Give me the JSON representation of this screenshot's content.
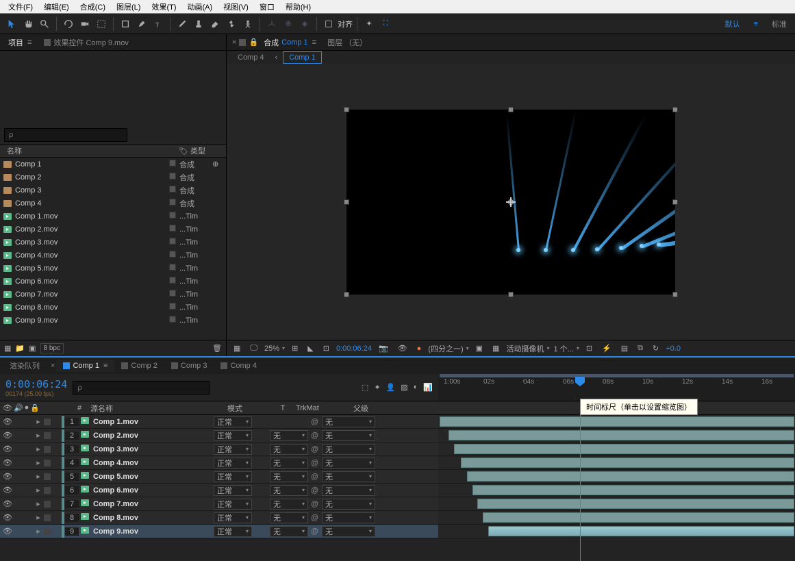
{
  "menu": [
    "文件(F)",
    "编辑(E)",
    "合成(C)",
    "图层(L)",
    "效果(T)",
    "动画(A)",
    "视图(V)",
    "窗口",
    "帮助(H)"
  ],
  "toolbar_right": {
    "snap": "对齐",
    "ws_default": "默认",
    "ws_standard": "标准"
  },
  "project": {
    "tab_project": "项目",
    "tab_effects": "效果控件 Comp 9.mov",
    "search_placeholder": "ρ",
    "col_name": "名称",
    "col_type": "类型",
    "items": [
      {
        "name": "Comp 1",
        "type": "合成",
        "icon": "comp",
        "link": true
      },
      {
        "name": "Comp 2",
        "type": "合成",
        "icon": "comp"
      },
      {
        "name": "Comp 3",
        "type": "合成",
        "icon": "comp"
      },
      {
        "name": "Comp 4",
        "type": "合成",
        "icon": "comp"
      },
      {
        "name": "Comp 1.mov",
        "type": "...Tim",
        "icon": "mov"
      },
      {
        "name": "Comp 2.mov",
        "type": "...Tim",
        "icon": "mov"
      },
      {
        "name": "Comp 3.mov",
        "type": "...Tim",
        "icon": "mov"
      },
      {
        "name": "Comp 4.mov",
        "type": "...Tim",
        "icon": "mov"
      },
      {
        "name": "Comp 5.mov",
        "type": "...Tim",
        "icon": "mov"
      },
      {
        "name": "Comp 6.mov",
        "type": "...Tim",
        "icon": "mov"
      },
      {
        "name": "Comp 7.mov",
        "type": "...Tim",
        "icon": "mov"
      },
      {
        "name": "Comp 8.mov",
        "type": "...Tim",
        "icon": "mov"
      },
      {
        "name": "Comp 9.mov",
        "type": "...Tim",
        "icon": "mov"
      }
    ],
    "bpc": "8 bpc"
  },
  "comp": {
    "tab_prefix": "合成",
    "tab_name": "Comp 1",
    "tab_layer": "图层 （无）",
    "crumb1": "Comp 4",
    "crumb2": "Comp 1"
  },
  "viewer": {
    "zoom": "25%",
    "time": "0:00:06:24",
    "res": "(四分之一)",
    "camera": "活动摄像机",
    "views": "1 个...",
    "exposure": "+0.0"
  },
  "timeline": {
    "tab_render": "渲染队列",
    "tabs": [
      "Comp 1",
      "Comp 2",
      "Comp 3",
      "Comp 4"
    ],
    "timecode": "0:00:06:24",
    "timecode_sub": "00174 (25.00 fps)",
    "search_placeholder": "ρ",
    "tooltip": "时间标尺（单击以设置缩览图）",
    "ticks": [
      "1:00s",
      "02s",
      "04s",
      "06s",
      "08s",
      "10s",
      "12s",
      "14s",
      "16s"
    ],
    "col_num": "#",
    "col_source": "源名称",
    "col_mode": "模式",
    "col_t": "T",
    "col_trk": "TrkMat",
    "col_parent": "父级",
    "mode_val": "正常",
    "trk_val": "无",
    "parent_val": "无",
    "layers": [
      {
        "num": 1,
        "name": "Comp 1.mov",
        "start": 2,
        "end": 520
      },
      {
        "num": 2,
        "name": "Comp 2.mov",
        "start": 15,
        "end": 520
      },
      {
        "num": 3,
        "name": "Comp 3.mov",
        "start": 23,
        "end": 520
      },
      {
        "num": 4,
        "name": "Comp 4.mov",
        "start": 33,
        "end": 520
      },
      {
        "num": 5,
        "name": "Comp 5.mov",
        "start": 42,
        "end": 520
      },
      {
        "num": 6,
        "name": "Comp 6.mov",
        "start": 50,
        "end": 520
      },
      {
        "num": 7,
        "name": "Comp 7.mov",
        "start": 57,
        "end": 520
      },
      {
        "num": 8,
        "name": "Comp 8.mov",
        "start": 65,
        "end": 520
      },
      {
        "num": 9,
        "name": "Comp 9.mov",
        "start": 73,
        "end": 520,
        "selected": true
      }
    ]
  }
}
